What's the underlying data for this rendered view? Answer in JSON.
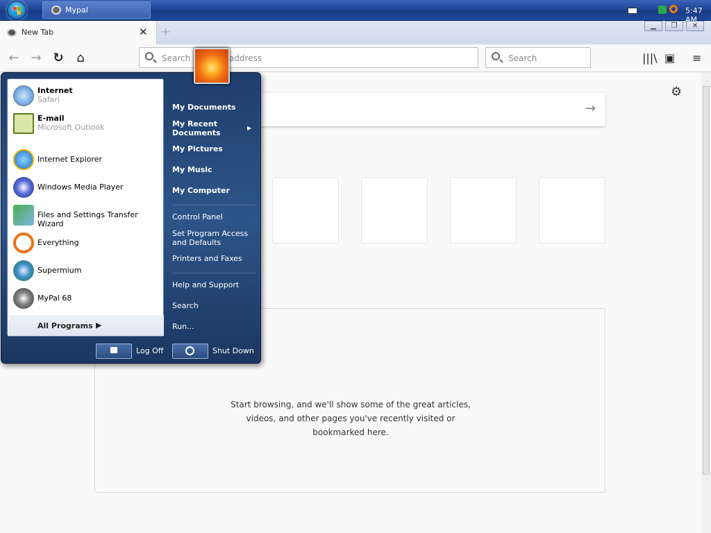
{
  "taskbar": {
    "task_title": "Mypal",
    "clock": "5:47 AM"
  },
  "browser": {
    "tab_title": "New Tab",
    "tab_close": "✕",
    "new_tab": "+",
    "url_placeholder": "Search or enter address",
    "search_placeholder": "Search",
    "empty_message_lines": [
      "Start browsing, and we'll show some of the great articles,",
      "videos, and other pages you've recently visited or",
      "bookmarked here."
    ]
  },
  "start_menu": {
    "pinned": [
      {
        "name": "Internet",
        "sub": "Safari",
        "icon": "safari-icon"
      },
      {
        "name": "E-mail",
        "sub": "Microsoft Outlook",
        "icon": "outlook-icon"
      }
    ],
    "recent": [
      {
        "name": "Internet Explorer",
        "icon": "ie-icon"
      },
      {
        "name": "Windows Media Player",
        "icon": "wmp-icon"
      },
      {
        "name": "Files and Settings Transfer Wizard",
        "icon": "transfer-wizard-icon"
      },
      {
        "name": "Everything",
        "icon": "everything-search-icon"
      },
      {
        "name": "Supermium",
        "icon": "supermium-icon"
      },
      {
        "name": "MyPal 68",
        "icon": "mypal-icon"
      }
    ],
    "all_programs": "All Programs",
    "places": {
      "my_documents": "My Documents",
      "my_recent_documents_1": "My Recent",
      "my_recent_documents_2": "Documents",
      "my_pictures": "My Pictures",
      "my_music": "My Music",
      "my_computer": "My Computer",
      "control_panel": "Control Panel",
      "set_program_1": "Set Program Access",
      "set_program_2": "and Defaults",
      "printers": "Printers and Faxes",
      "help": "Help and Support",
      "search": "Search",
      "run": "Run..."
    },
    "log_off": "Log Off",
    "shut_down": "Shut Down"
  }
}
